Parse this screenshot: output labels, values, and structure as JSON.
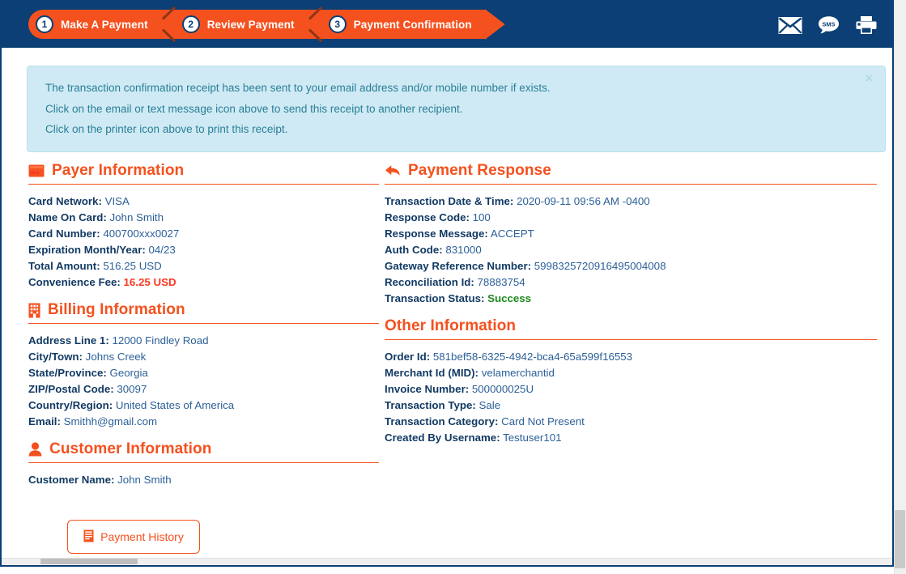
{
  "wizard": {
    "steps": [
      {
        "num": "1",
        "label": "Make A Payment"
      },
      {
        "num": "2",
        "label": "Review Payment"
      },
      {
        "num": "3",
        "label": "Payment Confirmation"
      }
    ]
  },
  "topbar": {
    "icons": [
      {
        "name": "email-icon",
        "semantic": "envelope"
      },
      {
        "name": "sms-icon",
        "semantic": "sms-bubble",
        "text": "SMS"
      },
      {
        "name": "print-icon",
        "semantic": "printer"
      }
    ]
  },
  "alert": {
    "lines": [
      "The transaction confirmation receipt has been sent to your email address and/or mobile number if exists.",
      "Click on the email or text message icon above to send this receipt to another recipient.",
      "Click on the printer icon above to print this receipt."
    ],
    "close": "×"
  },
  "sections": {
    "payer": {
      "title": "Payer Information",
      "icon": "credit-card-icon",
      "fields": [
        {
          "label": "Card Network:",
          "value": "VISA"
        },
        {
          "label": "Name On Card:",
          "value": "John Smith"
        },
        {
          "label": "Card Number:",
          "value": "400700xxx0027"
        },
        {
          "label": "Expiration Month/Year:",
          "value": "04/23"
        },
        {
          "label": "Total Amount:",
          "value": "516.25 USD"
        },
        {
          "label": "Convenience Fee:",
          "value": "16.25 USD",
          "style": "fee"
        }
      ]
    },
    "billing": {
      "title": "Billing Information",
      "icon": "building-icon",
      "fields": [
        {
          "label": "Address Line 1:",
          "value": "12000 Findley Road"
        },
        {
          "label": "City/Town:",
          "value": "Johns Creek"
        },
        {
          "label": "State/Province:",
          "value": "Georgia"
        },
        {
          "label": "ZIP/Postal Code:",
          "value": "30097"
        },
        {
          "label": "Country/Region:",
          "value": "United States of America"
        },
        {
          "label": "Email:",
          "value": "Smithh@gmail.com"
        }
      ]
    },
    "customer": {
      "title": "Customer Information",
      "icon": "user-icon",
      "fields": [
        {
          "label": "Customer Name:",
          "value": "John Smith"
        }
      ]
    },
    "response": {
      "title": "Payment Response",
      "icon": "reply-arrow-icon",
      "fields": [
        {
          "label": "Transaction Date & Time:",
          "value": "2020-09-11 09:56 AM -0400"
        },
        {
          "label": "Response Code:",
          "value": "100"
        },
        {
          "label": "Response Message:",
          "value": "ACCEPT"
        },
        {
          "label": "Auth Code:",
          "value": "831000"
        },
        {
          "label": "Gateway Reference Number:",
          "value": "5998325720916495004008"
        },
        {
          "label": "Reconciliation Id:",
          "value": "78883754"
        },
        {
          "label": "Transaction Status:",
          "value": "Success",
          "style": "success"
        }
      ]
    },
    "other": {
      "title": "Other Information",
      "icon": "none",
      "fields": [
        {
          "label": "Order Id:",
          "value": "581bef58-6325-4942-bca4-65a599f16553"
        },
        {
          "label": "Merchant Id (MID):",
          "value": "velamerchantid"
        },
        {
          "label": "Invoice Number:",
          "value": "500000025U"
        },
        {
          "label": "Transaction Type:",
          "value": "Sale"
        },
        {
          "label": "Transaction Category:",
          "value": "Card Not Present"
        },
        {
          "label": "Created By Username:",
          "value": "Testuser101"
        }
      ]
    }
  },
  "buttons": {
    "payment_history": "Payment History"
  },
  "colors": {
    "navy": "#0b3f75",
    "orange": "#f4511e",
    "alert_bg": "#cfeaf4",
    "alert_text": "#2a7f97",
    "label": "#123a63",
    "value": "#2d6099",
    "fee_red": "#f93822",
    "success_green": "#1d8a1d"
  }
}
